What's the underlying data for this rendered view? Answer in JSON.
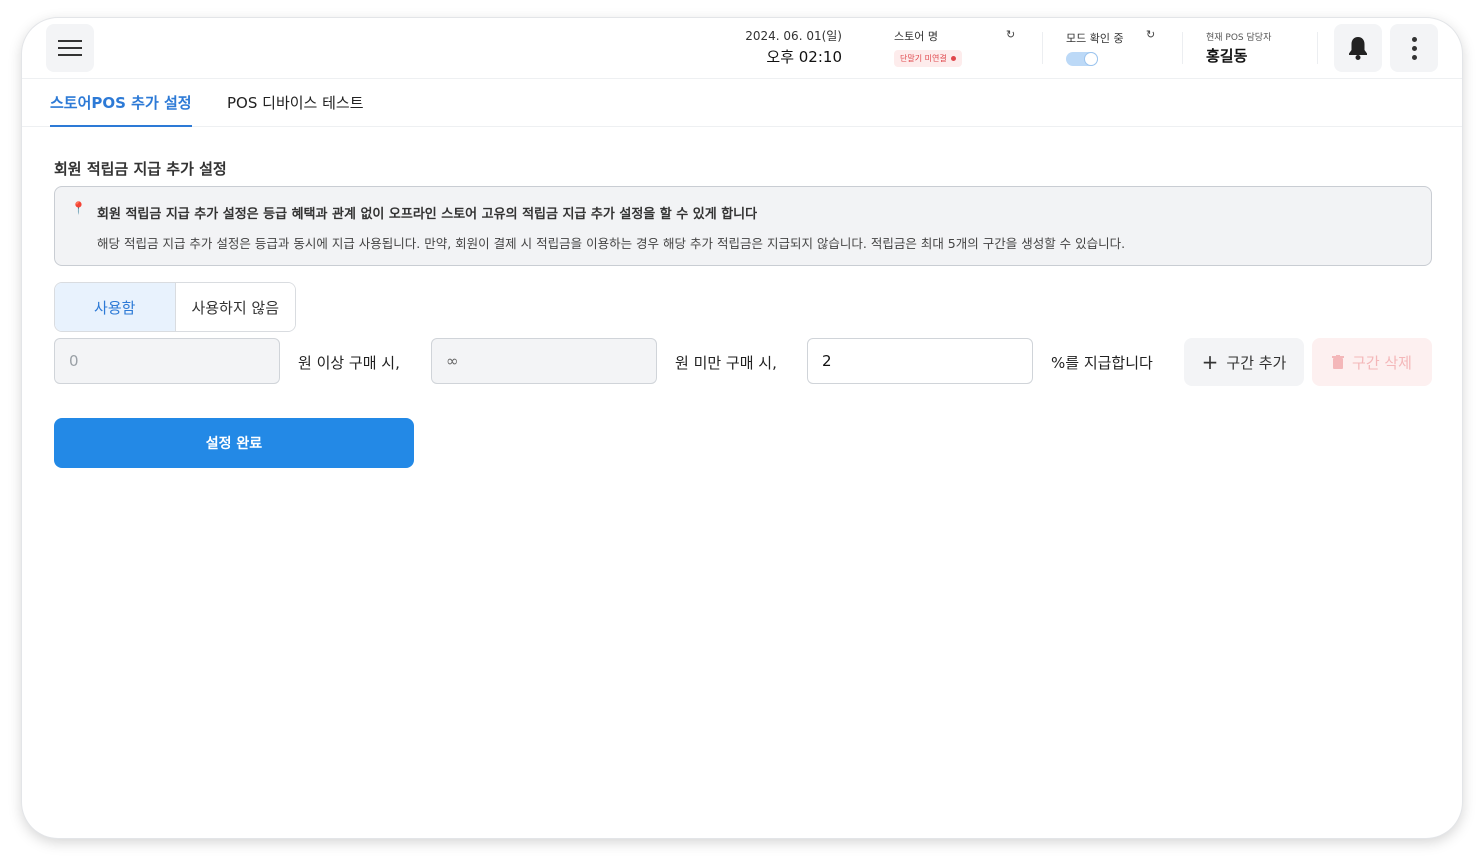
{
  "header": {
    "date": "2024. 06. 01(일)",
    "time": "오후 02:10",
    "store_label": "스토어 명",
    "store_status": "단말기 미연결",
    "mode_label": "모드 확인 중",
    "manager_label": "현재 POS 담당자",
    "manager_name": "홍길동",
    "refresh_glyph": "↻"
  },
  "tabs": [
    {
      "label": "스토어POS 추가 설정",
      "active": true
    },
    {
      "label": "POS 디바이스 테스트",
      "active": false
    }
  ],
  "section": {
    "title": "회원 적립금 지급 추가 설정",
    "notice_title": "회원 적립금 지급 추가 설정은 등급 혜택과 관계 없이 오프라인 스토어 고유의 적립금 지급 추가 설정을 할 수 있게 합니다",
    "notice_body": "해당 적립금 지급 추가 설정은 등급과 동시에 지급 사용됩니다. 만약, 회원이 결제 시 적립금을 이용하는 경우 해당 추가 적립금은 지급되지 않습니다. 적립금은 최대 5개의 구간을 생성할 수 있습니다."
  },
  "toggle_options": {
    "use": "사용함",
    "not_use": "사용하지 않음"
  },
  "range_row": {
    "min_value": "0",
    "min_suffix": "원 이상 구매 시,",
    "max_value": "∞",
    "max_suffix": "원 미만 구매 시,",
    "percent_value": "2",
    "percent_suffix": "%를 지급합니다",
    "add_label": "구간 추가",
    "delete_label": "구간 삭제"
  },
  "submit_label": "설정 완료",
  "colors": {
    "accent": "#2389e6",
    "tab_active": "#2d7ad6",
    "danger": "#e0474c"
  }
}
